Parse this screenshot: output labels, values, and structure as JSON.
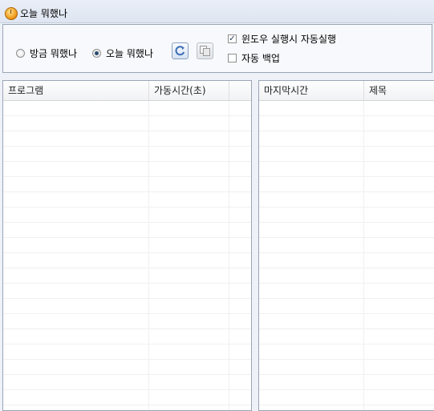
{
  "window": {
    "title": "오늘 뭐했나"
  },
  "toolbar": {
    "radio_just_now": "방금 뭐했나",
    "radio_today": "오늘 뭐했나",
    "radio_selected": "today",
    "check_autostart": "윈도우 실행시 자동실행",
    "check_autostart_checked": true,
    "check_autobackup": "자동 백업",
    "check_autobackup_checked": false,
    "refresh_icon": "refresh-icon",
    "copy_icon": "copy-icon"
  },
  "left_list": {
    "columns": [
      "프로그램",
      "가동시간(초)",
      ""
    ],
    "rows": []
  },
  "right_list": {
    "columns": [
      "마지막시간",
      "제목"
    ],
    "rows": []
  },
  "colors": {
    "accent": "#3d6fb6",
    "border": "#9aa6b5",
    "background": "#eef2f8"
  }
}
